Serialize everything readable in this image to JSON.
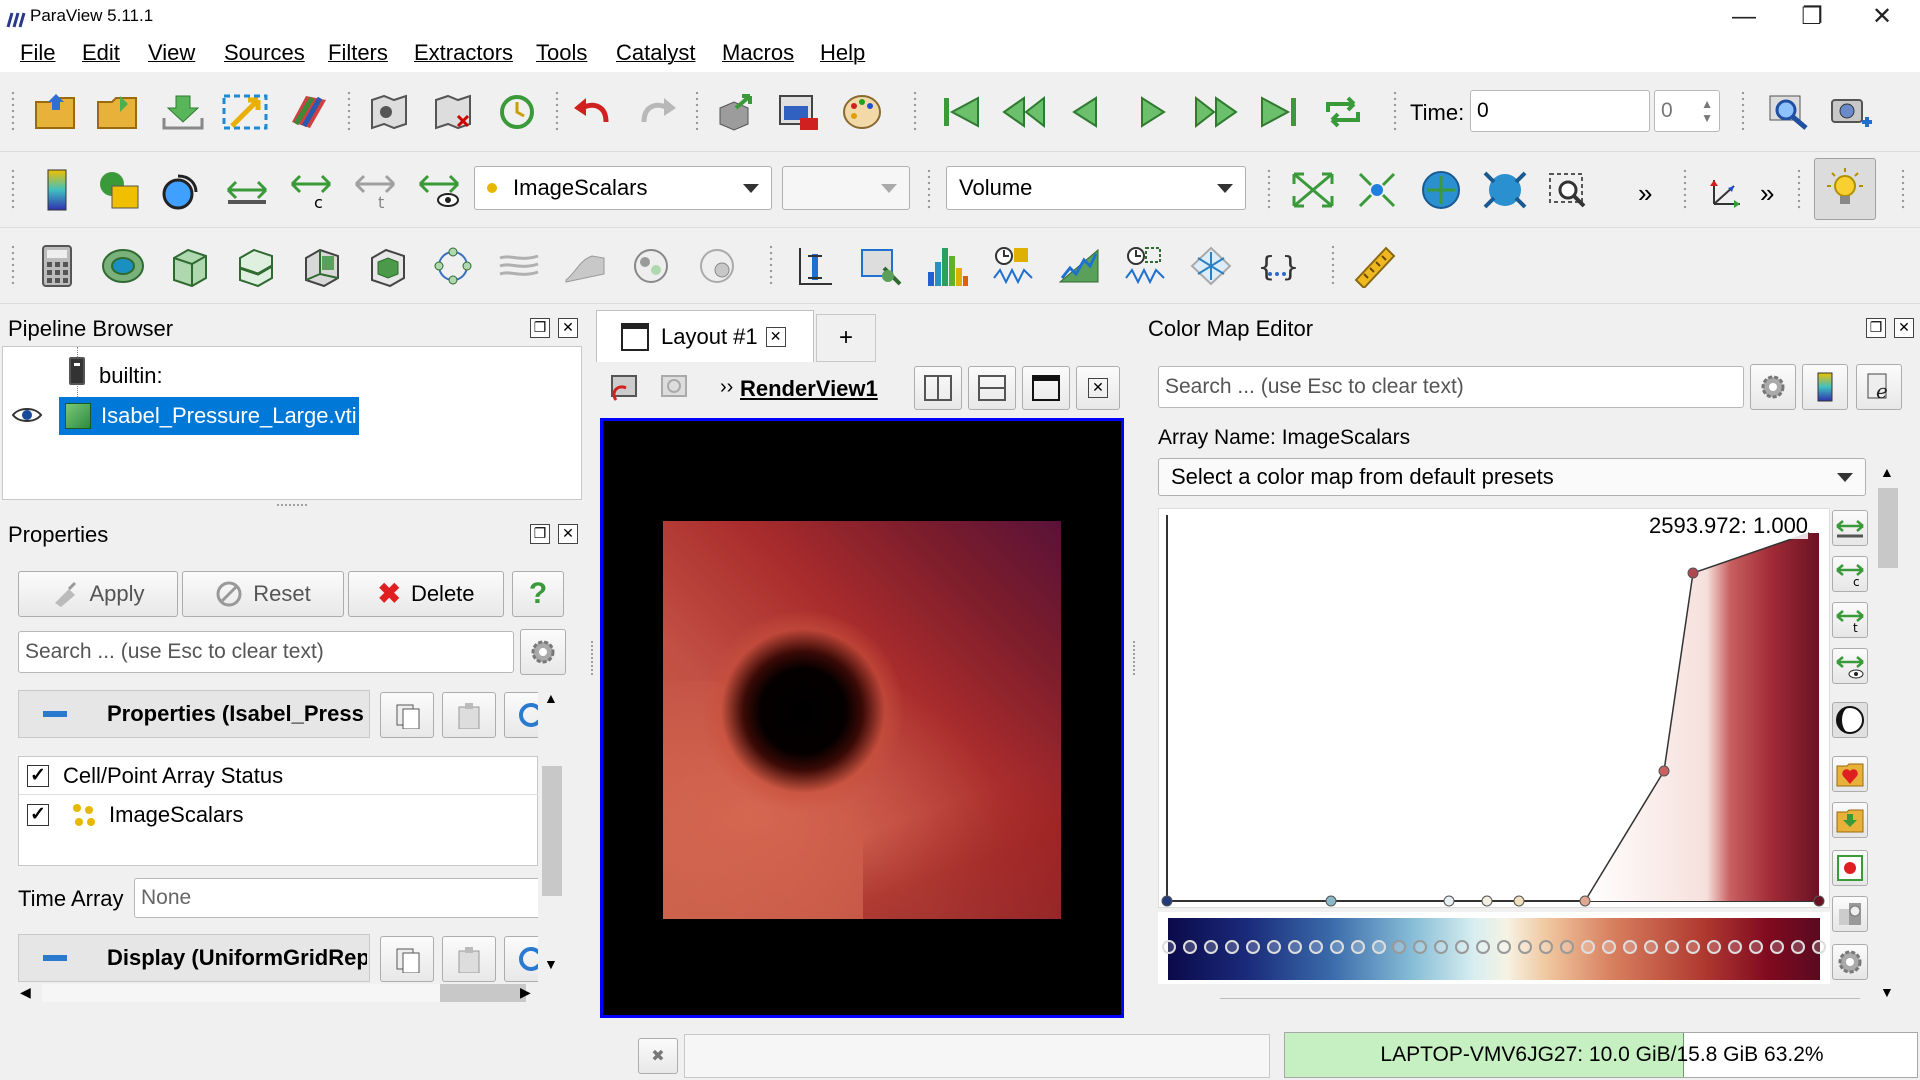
{
  "window": {
    "title": "ParaView 5.11.1",
    "minimize": "—",
    "restore": "❐",
    "close": "✕"
  },
  "menu": [
    "File",
    "Edit",
    "View",
    "Sources",
    "Filters",
    "Extractors",
    "Tools",
    "Catalyst",
    "Macros",
    "Help"
  ],
  "toolbar1": {
    "time_label": "Time:",
    "time_value": "0",
    "timestep_value": "0"
  },
  "toolbar2": {
    "color_by": "ImageScalars",
    "component": "",
    "representation": "Volume",
    "more": "»"
  },
  "pipeline": {
    "title": "Pipeline Browser",
    "server": "builtin:",
    "source": "Isabel_Pressure_Large.vti"
  },
  "properties": {
    "title": "Properties",
    "apply": "Apply",
    "reset": "Reset",
    "delete": "Delete",
    "help": "?",
    "search_placeholder": "Search ... (use Esc to clear text)",
    "section1": "Properties (Isabel_Press",
    "array_status_header": "Cell/Point Array Status",
    "array_item": "ImageScalars",
    "time_array_label": "Time Array",
    "time_array_value": "None",
    "section2": "Display (UniformGridRep"
  },
  "layout": {
    "tab_label": "Layout #1",
    "add_tab": "+",
    "view_name": "RenderView1",
    "view_prefix": "››"
  },
  "colormap": {
    "title": "Color Map Editor",
    "search_placeholder": "Search ... (use Esc to clear text)",
    "array_name": "Array Name: ImageScalars",
    "preset_prompt": "Select a color map from default presets",
    "readout": "2593.972:  1.000"
  },
  "status": {
    "memory": "LAPTOP-VMV6JG27: 10.0 GiB/15.8 GiB 63.2%",
    "memory_fraction": 0.632
  },
  "colors": {
    "accent_blue": "#0000ff",
    "selection": "#0078d7",
    "memory_bar": "#c6f0c2"
  }
}
